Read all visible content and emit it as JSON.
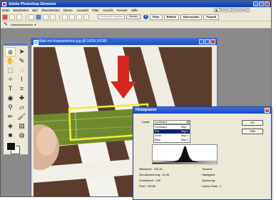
{
  "app": {
    "title": "Adobe Photoshop Elements"
  },
  "menu": {
    "items": [
      "Datei",
      "Bearbeiten",
      "Bild",
      "Überarbeiten",
      "Ebene",
      "Auswahl",
      "Filter",
      "Ansicht",
      "Fenster",
      "Hilfe"
    ],
    "language": "Deutsch (Deutschland)"
  },
  "toolbar": {
    "search_placeholder": "Suchbegriff eingeben",
    "search_button": "Suchen",
    "palette_tabs": [
      "Filter",
      "Effekte",
      "Ebenenstile",
      "Fotoeff"
    ]
  },
  "options": {
    "tool_label": "Aufnahmebereich"
  },
  "document": {
    "title": "Blatt mit Analysekontur.jpg @ 100% (RGB)"
  },
  "histogram": {
    "title": "Histogramm",
    "channel_label": "Kanal:",
    "channel_value": "Luminanz",
    "channels": [
      {
        "name": "Luminanz",
        "shortcut": "Strg+~"
      },
      {
        "name": "Rot",
        "shortcut": "Strg+1"
      },
      {
        "name": "Grün",
        "shortcut": "Strg+2"
      },
      {
        "name": "Blau",
        "shortcut": "Strg+3"
      }
    ],
    "selected_channel": "Rot",
    "ok_label": "OK",
    "help_label": "Hilfe",
    "stats_left": [
      {
        "label": "Mittelwert:",
        "value": "105,19"
      },
      {
        "label": "Std-Abweichung:",
        "value": "11,98"
      },
      {
        "label": "Zentralwert:",
        "value": "106"
      },
      {
        "label": "Pixel:",
        "value": "34758"
      }
    ],
    "stats_right": [
      {
        "label": "Tonwert:",
        "value": ""
      },
      {
        "label": "Häufigkeit:",
        "value": ""
      },
      {
        "label": "Spreizung:",
        "value": ""
      },
      {
        "label": "Cache-Stufe:",
        "value": "1"
      }
    ]
  },
  "colors": {
    "accent_red": "#d9251d",
    "selection_outline": "#f2ee2b",
    "leaf_green": "#6f8a2c"
  }
}
